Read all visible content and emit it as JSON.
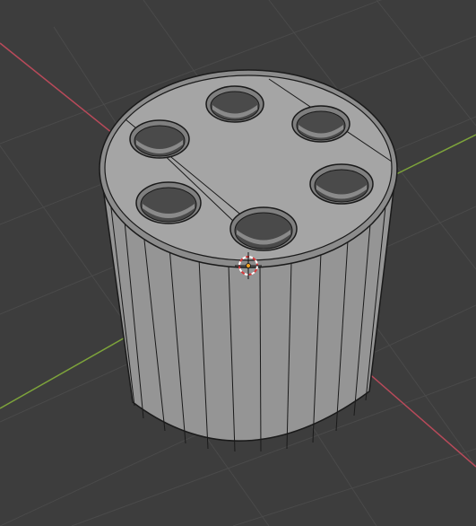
{
  "viewport": {
    "background_color": "#3d3d3d",
    "grid_color": "#4a4a4a",
    "x_axis_color": "#b84a5a",
    "y_axis_color": "#7da33b"
  },
  "object": {
    "type": "cylinder",
    "hole_count": 6,
    "side_face_color": "#959595",
    "top_face_color": "#a5a5a5",
    "wire_color": "#1a1a1a"
  },
  "origin_marker": {
    "icon": "3d-cursor-icon",
    "ring_colors": [
      "#ffffff",
      "#d9383a"
    ]
  }
}
